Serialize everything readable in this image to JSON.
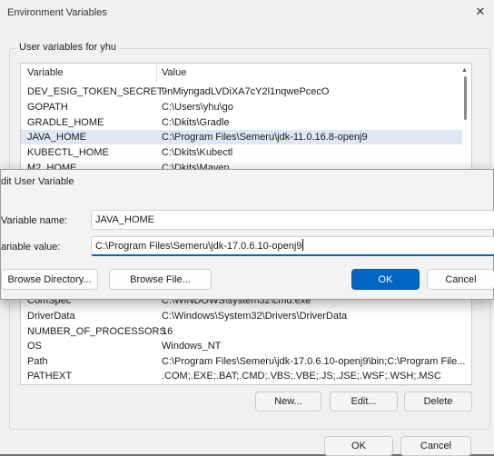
{
  "env_window": {
    "title": "Environment Variables",
    "close_glyph": "✕",
    "user_group_label": "User variables for yhu",
    "user_table": {
      "headers": [
        "Variable",
        "Value"
      ],
      "rows": [
        [
          "DEV_ESIG_TOKEN_SECRET",
          "9nMiyngadLVDiXA7cY2l1nqwePcecO"
        ],
        [
          "GOPATH",
          "C:\\Users\\yhu\\go"
        ],
        [
          "GRADLE_HOME",
          "C:\\Dkits\\Gradle"
        ],
        [
          "JAVA_HOME",
          "C:\\Program Files\\Semeru\\jdk-11.0.16.8-openj9"
        ],
        [
          "KUBECTL_HOME",
          "C:\\Dkits\\Kubectl"
        ],
        [
          "M2_HOME",
          "C:\\Dkits\\Maven"
        ]
      ],
      "selected_row": 3
    },
    "system_table": {
      "rows": [
        [
          "ComSpec",
          "C:\\WINDOWS\\system32\\cmd.exe"
        ],
        [
          "DriverData",
          "C:\\Windows\\System32\\Drivers\\DriverData"
        ],
        [
          "NUMBER_OF_PROCESSORS",
          "16"
        ],
        [
          "OS",
          "Windows_NT"
        ],
        [
          "Path",
          "C:\\Program Files\\Semeru\\jdk-17.0.6.10-openj9\\bin;C:\\Program File..."
        ],
        [
          "PATHEXT",
          ".COM;.EXE;.BAT;.CMD;.VBS;.VBE;.JS;.JSE;.WSF;.WSH;.MSC"
        ]
      ]
    },
    "buttons": {
      "new": "New...",
      "edit": "Edit...",
      "delete": "Delete",
      "ok": "OK",
      "cancel": "Cancel"
    }
  },
  "edit_dialog": {
    "title": "dit User Variable",
    "name_label": "Variable name:",
    "name_value": "JAVA_HOME",
    "value_label": "ariable value:",
    "value_value": "C:\\Program Files\\Semeru\\jdk-17.0.6.10-openj9",
    "buttons": {
      "browse_directory": "Browse Directory...",
      "browse_file": "Browse File...",
      "ok": "OK",
      "cancel": "Cancel"
    }
  },
  "colors": {
    "accent": "#0067c0",
    "selection": "#dde8f4",
    "overlay": "#6e6e6e"
  }
}
